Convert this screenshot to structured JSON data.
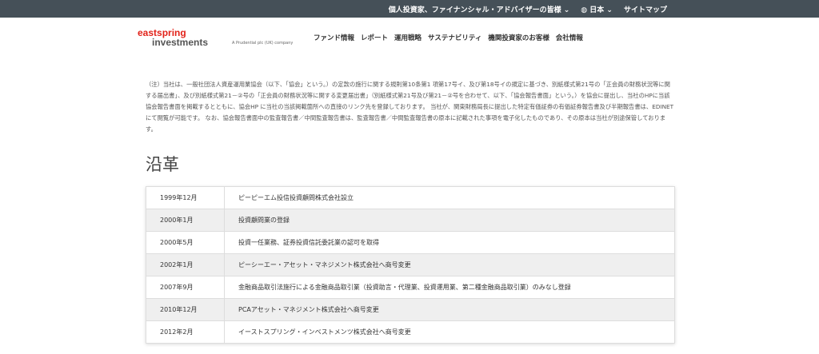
{
  "topbar": {
    "audience": "個人投資家、ファイナンシャル・アドバイザーの皆様 ⌄",
    "language": "日本 ⌄",
    "sitemap": "サイトマップ"
  },
  "logo": {
    "line1": "eastspring",
    "line2": "investments",
    "tagline": "A Prudential plc (UK) company"
  },
  "nav": [
    "ファンド情報",
    "レポート",
    "運用戦略",
    "サステナビリティ",
    "機関投資家のお客様",
    "会社情報"
  ],
  "note": "（注）当社は、一般社団法人資産運用業協会（以下、「協会」という。）の定款の施行に関する規則第10条第1 項第17号イ、及び第18号イの規定に基づき、別紙様式第21号の「正会員の財務状況等に関する届出書」、及び別紙様式第21－②号の「正会員の財務状況等に関する変更届出書」（別紙様式第21号及び第21－②号を合わせて、以下、「協会報告書面」という。）を協会に提出し、当社のHPに当該協会報告書面を掲載するとともに、協会HP に当社の当該掲載箇所への直接のリンク先を登録しております。 当社が、関東財務局長に提出した特定有価証券の有価証券報告書及び半期報告書は、EDINET にて閲覧が可能です。 なお、協会報告書面中の監査報告書／中間監査報告書は、監査報告書／中間監査報告書の原本に記載された事項を電子化したものであり、その原本は当社が別途保管しております。",
  "history": {
    "title": "沿革",
    "rows": [
      {
        "date": "1999年12月",
        "event": "ピーピーエム投信投資顧問株式会社設立"
      },
      {
        "date": "2000年1月",
        "event": "投資顧問業の登録"
      },
      {
        "date": "2000年5月",
        "event": "投資一任業務、証券投資信託委託業の認可を取得"
      },
      {
        "date": "2002年1月",
        "event": "ピーシーエー・アセット・マネジメント株式会社へ商号変更"
      },
      {
        "date": "2007年9月",
        "event": "金融商品取引法施行による金融商品取引業（投資助言・代理業、投資運用業、第二種金融商品取引業）のみなし登録"
      },
      {
        "date": "2010年12月",
        "event": "PCAアセット・マネジメント株式会社へ商号変更"
      },
      {
        "date": "2012年2月",
        "event": "イーストスプリング・インベストメンツ株式会社へ商号変更"
      }
    ]
  }
}
